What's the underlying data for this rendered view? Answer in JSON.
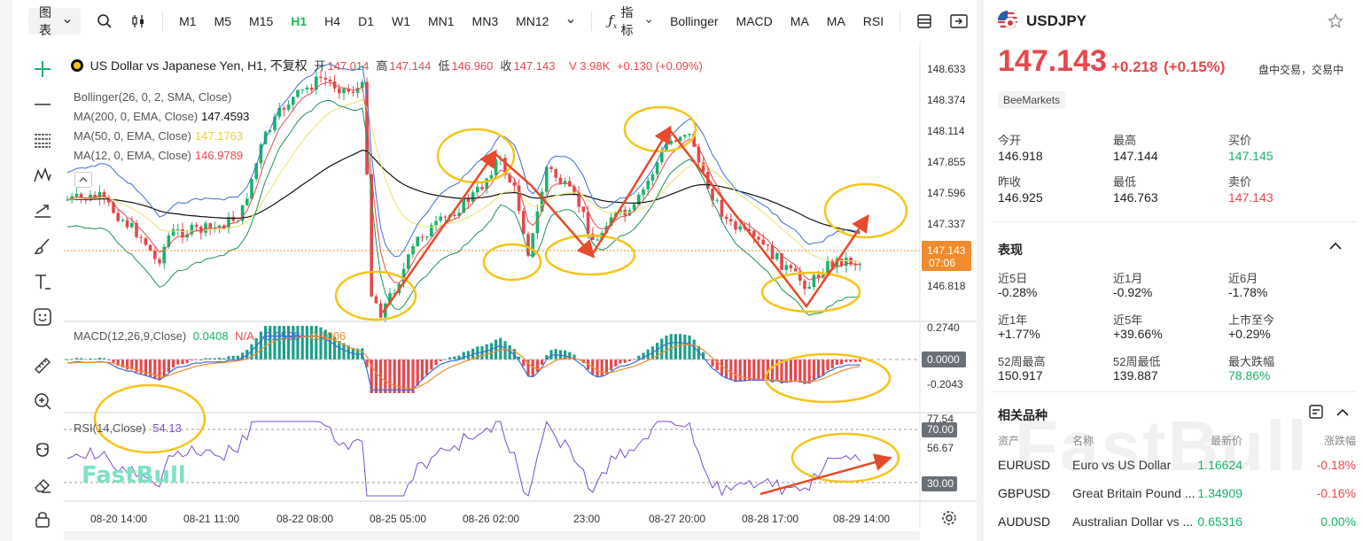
{
  "toolbar": {
    "chart_type_label": "图表",
    "timeframes": [
      "M1",
      "M5",
      "M15",
      "H1",
      "H4",
      "D1",
      "W1",
      "MN1",
      "MN3",
      "MN12"
    ],
    "active_timeframe": "H1",
    "indicator_label": "指标",
    "indicators": [
      "Bollinger",
      "MACD",
      "MA",
      "MA",
      "RSI"
    ]
  },
  "chart": {
    "symbol_title": "US Dollar vs Japanese Yen, H1, 不复权",
    "ohlc": [
      {
        "label": "开",
        "value": "147.014"
      },
      {
        "label": "高",
        "value": "147.144"
      },
      {
        "label": "低",
        "value": "146.960"
      },
      {
        "label": "收",
        "value": "147.143"
      }
    ],
    "volume": "V 3.98K",
    "change": "+0.130 (+0.09%)",
    "legends": [
      {
        "name": "Bollinger(26, 0, 2, SMA, Close)",
        "value": "",
        "color": "#555555"
      },
      {
        "name": "MA(200, 0, EMA, Close)",
        "value": "147.4593",
        "color": "#111111"
      },
      {
        "name": "MA(50, 0, EMA, Close)",
        "value": "147.1763",
        "color": "#e8d23a"
      },
      {
        "name": "MA(12, 0, EMA, Close)",
        "value": "146.9789",
        "color": "#e5484d"
      }
    ],
    "price_axis": [
      "148.633",
      "148.374",
      "148.114",
      "147.855",
      "147.596",
      "147.337",
      "146.818"
    ],
    "current_price": "147.143",
    "countdown": "07:06",
    "macd": {
      "title": "MACD(12,26,9,Close)",
      "hist": "0.0408",
      "macd_na": "N/A",
      "signal": "-0.0598",
      "diff": "-0.1006",
      "axis": [
        "0.2740",
        "0.0000",
        "-0.2043"
      ]
    },
    "rsi": {
      "title": "RSI(14,Close)",
      "value": "54.13",
      "axis": [
        "77.54",
        "70.00",
        "56.67",
        "30.00"
      ]
    },
    "time_axis": [
      "08-20 14:00",
      "08-21 11:00",
      "08-22 08:00",
      "08-25 05:00",
      "08-26 02:00",
      "23:00",
      "08-27 20:00",
      "08-28 17:00",
      "08-29 14:00"
    ],
    "logo": "FastBull"
  },
  "panel": {
    "symbol": "USDJPY",
    "price": "147.143",
    "change": "+0.218",
    "change_pct": "(+0.15%)",
    "status": "盘中交易，交易中",
    "broker": "BeeMarkets",
    "stats": [
      {
        "label": "今开",
        "value": "146.918",
        "color": "default"
      },
      {
        "label": "最高",
        "value": "147.144",
        "color": "default"
      },
      {
        "label": "买价",
        "value": "147.145",
        "color": "green"
      },
      {
        "label": "昨收",
        "value": "146.925",
        "color": "default"
      },
      {
        "label": "最低",
        "value": "146.763",
        "color": "default"
      },
      {
        "label": "卖价",
        "value": "147.143",
        "color": "red"
      }
    ],
    "performance_title": "表现",
    "performance": [
      {
        "label": "近5日",
        "value": "-0.28%",
        "color": "default"
      },
      {
        "label": "近1月",
        "value": "-0.92%",
        "color": "default"
      },
      {
        "label": "近6月",
        "value": "-1.78%",
        "color": "default"
      },
      {
        "label": "近1年",
        "value": "+1.77%",
        "color": "default"
      },
      {
        "label": "近5年",
        "value": "+39.66%",
        "color": "default"
      },
      {
        "label": "上市至今",
        "value": "+0.29%",
        "color": "default"
      },
      {
        "label": "52周最高",
        "value": "150.917",
        "color": "default"
      },
      {
        "label": "52周最低",
        "value": "139.887",
        "color": "default"
      },
      {
        "label": "最大跌幅",
        "value": "78.86%",
        "color": "green"
      }
    ],
    "related_title": "相关品种",
    "related_columns": [
      "资产",
      "名称",
      "最新价",
      "涨跌幅"
    ],
    "related": [
      {
        "code": "EURUSD",
        "name": "Euro vs US Dollar",
        "price": "1.16624",
        "change": "-0.18%"
      },
      {
        "code": "GBPUSD",
        "name": "Great Britain Pound ...",
        "price": "1.34909",
        "change": "-0.16%"
      },
      {
        "code": "AUDUSD",
        "name": "Australian Dollar vs ...",
        "price": "0.65316",
        "change": "0.00%"
      }
    ],
    "watermark": "FastBull",
    "colors": {
      "up": "#19b36b",
      "down": "#e5484d",
      "accent": "#1db954",
      "annotation": "#f5c518",
      "arrow": "#e84a2c"
    }
  }
}
